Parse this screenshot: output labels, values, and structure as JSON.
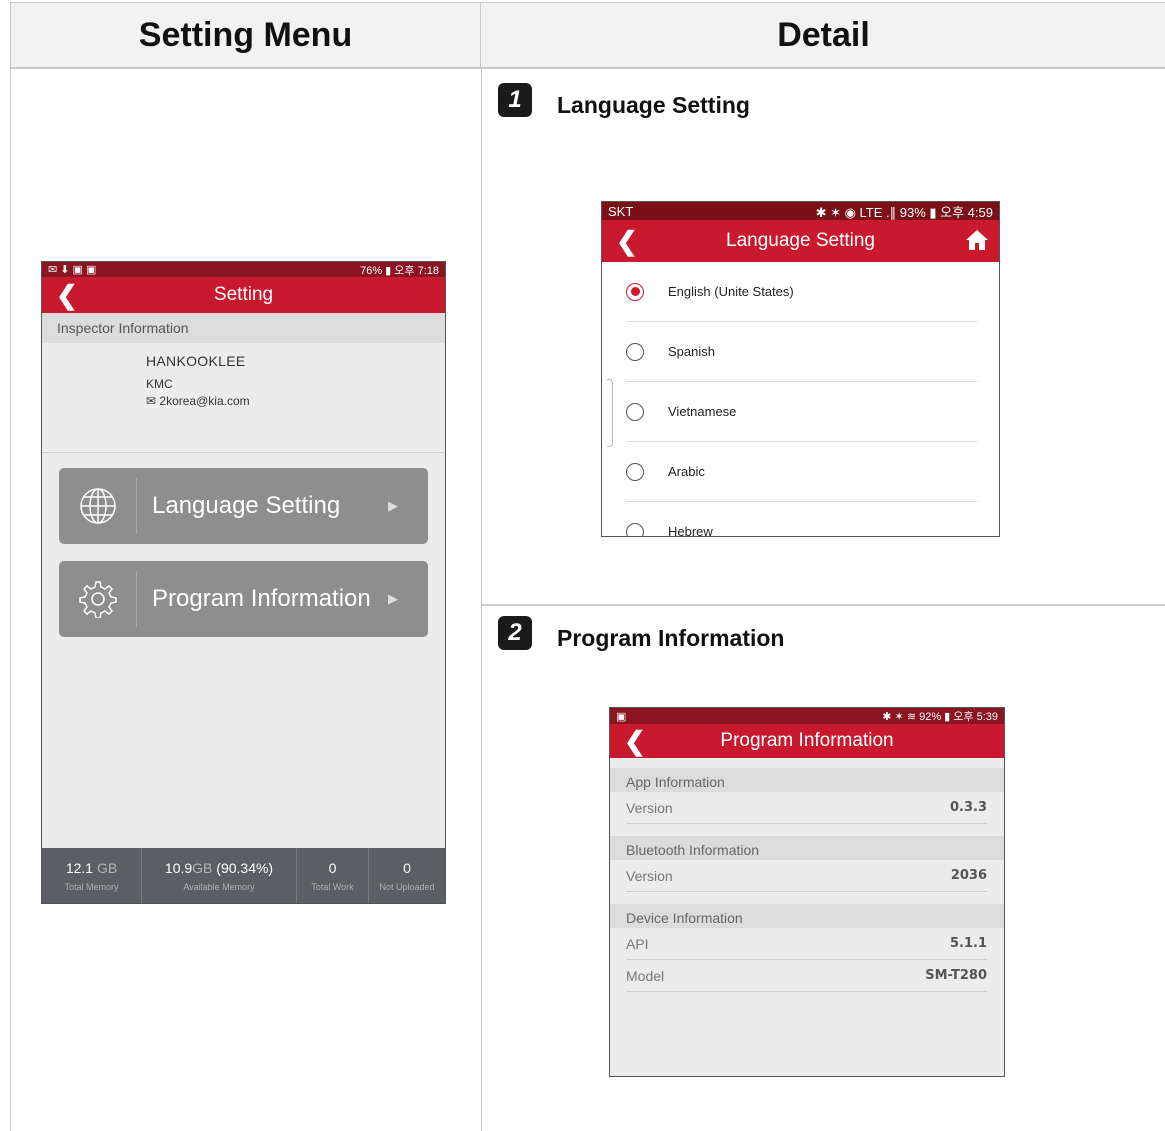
{
  "table": {
    "col_left_header": "Setting Menu",
    "col_right_header": "Detail"
  },
  "settings_screen": {
    "status_right": "76% ▮ 오후 7:18",
    "title": "Setting",
    "inspector_header": "Inspector Information",
    "inspector_name": "HANKOOKLEE",
    "inspector_org": "KMC",
    "inspector_email": "2korea@kia.com",
    "menu": [
      {
        "label": "Language Setting",
        "icon": "globe-icon"
      },
      {
        "label": "Program Information",
        "icon": "gear-icon"
      }
    ],
    "footer": {
      "total_memory_value": "12.1",
      "total_memory_unit": "GB",
      "total_memory_label": "Total Memory",
      "available_memory_value": "10.9",
      "available_memory_unit": "GB",
      "available_memory_percent": "(90.34%)",
      "available_memory_label": "Available Memory",
      "total_work_value": "0",
      "total_work_label": "Total Work",
      "not_uploaded_value": "0",
      "not_uploaded_label": "Not Uploaded"
    }
  },
  "detail_1": {
    "number": "1",
    "label": "Language Setting",
    "status_left": "SKT",
    "status_right": "✱ ✶ ◉ LTE .∥ 93% ▮ 오후 4:59",
    "title": "Language Setting",
    "languages": [
      {
        "label": "English (Unite States)",
        "selected": true
      },
      {
        "label": "Spanish",
        "selected": false
      },
      {
        "label": "Vietnamese",
        "selected": false
      },
      {
        "label": "Arabic",
        "selected": false
      },
      {
        "label": "Hebrew",
        "selected": false
      }
    ]
  },
  "detail_2": {
    "number": "2",
    "label": "Program Information",
    "status_right": "✱ ✶ ≋ 92% ▮ 오후 5:39",
    "title": "Program Information",
    "app_header": "App Information",
    "app_version_label": "Version",
    "app_version_value": "0.3.3",
    "bt_header": "Bluetooth Information",
    "bt_version_label": "Version",
    "bt_version_value": "2036",
    "device_header": "Device Information",
    "api_label": "API",
    "api_value": "5.1.1",
    "model_label": "Model",
    "model_value": "SM-T280"
  },
  "colors": {
    "accent_red": "#c8192e",
    "status_dark_red": "#8a1420",
    "menu_button_gray": "#8e8e8e",
    "footer_gray": "#5b5e62"
  }
}
